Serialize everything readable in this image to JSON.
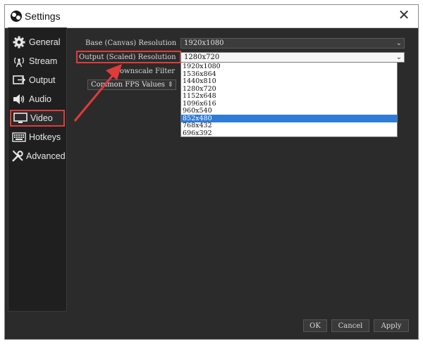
{
  "window": {
    "title": "Settings",
    "close_label": "✕"
  },
  "sidebar": {
    "items": [
      {
        "label": "General"
      },
      {
        "label": "Stream"
      },
      {
        "label": "Output"
      },
      {
        "label": "Audio"
      },
      {
        "label": "Video"
      },
      {
        "label": "Hotkeys"
      },
      {
        "label": "Advanced"
      }
    ]
  },
  "video": {
    "base_label": "Base (Canvas) Resolution",
    "base_value": "1920x1080",
    "output_label": "Output (Scaled) Resolution",
    "output_value": "1280x720",
    "downscale_label": "Downscale Filter",
    "fps_label": "Common FPS Values",
    "output_options": [
      "1920x1080",
      "1536x864",
      "1440x810",
      "1280x720",
      "1152x648",
      "1096x616",
      "960x540",
      "852x480",
      "768x432",
      "696x392"
    ],
    "highlighted_option": "852x480"
  },
  "buttons": {
    "ok": "OK",
    "cancel": "Cancel",
    "apply": "Apply"
  },
  "colors": {
    "accent": "#e23a3a",
    "selection": "#2f7bd8",
    "window_bg": "#2b2b2b"
  }
}
